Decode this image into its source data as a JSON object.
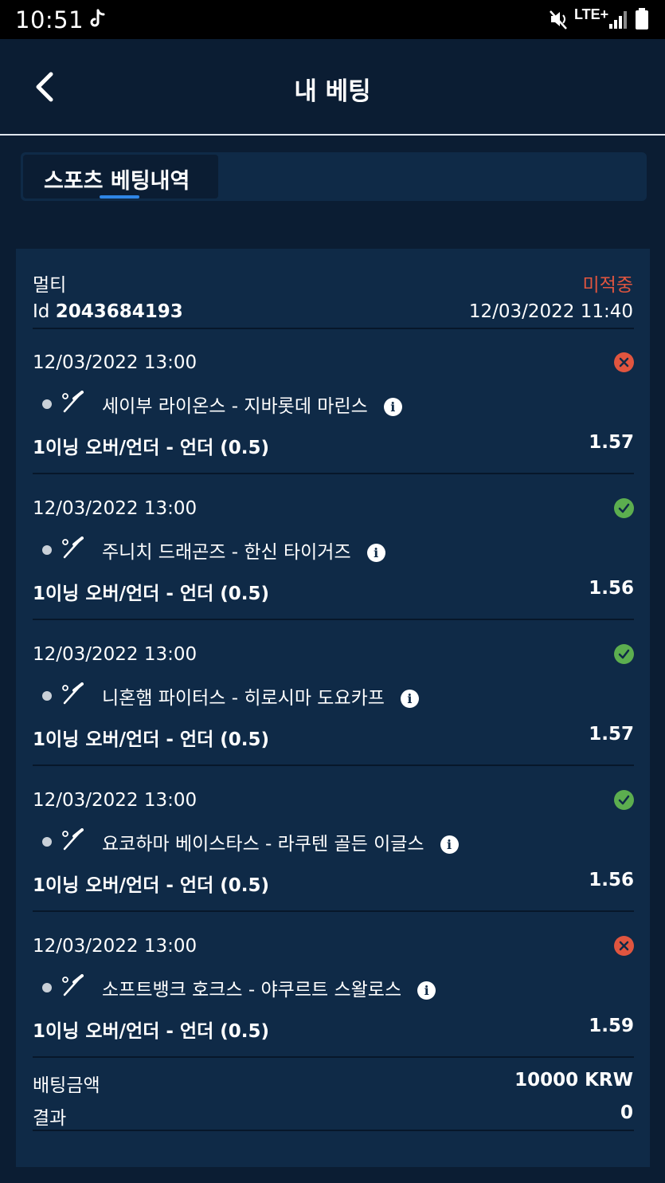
{
  "status_bar": {
    "time": "10:51",
    "icons": [
      "tiktok-icon",
      "mute-icon",
      "lte-icon",
      "signal-icon",
      "battery-icon"
    ],
    "network_label": "LTE+"
  },
  "header": {
    "title": "내 베팅",
    "back_icon": "chevron-left-icon"
  },
  "tabs": [
    {
      "label": "스포츠 베팅내역",
      "active": true
    }
  ],
  "bet": {
    "type": "멀티",
    "status": "미적중",
    "id_prefix": "Id",
    "id_number": "2043684193",
    "datetime": "12/03/2022 11:40",
    "selections": [
      {
        "date": "12/03/2022 13:00",
        "result": "lost",
        "event": "세이부 라이온스 - 지바롯데 마린스",
        "market": "1이닝 오버/언더 - 언더 (0.5)",
        "odds": "1.57"
      },
      {
        "date": "12/03/2022 13:00",
        "result": "won",
        "event": "주니치 드래곤즈 - 한신 타이거즈",
        "market": "1이닝 오버/언더 - 언더 (0.5)",
        "odds": "1.56"
      },
      {
        "date": "12/03/2022 13:00",
        "result": "won",
        "event": "니혼햄 파이터스 - 히로시마 도요카프",
        "market": "1이닝 오버/언더 - 언더 (0.5)",
        "odds": "1.57"
      },
      {
        "date": "12/03/2022 13:00",
        "result": "won",
        "event": "요코하마 베이스타스 - 라쿠텐 골든 이글스",
        "market": "1이닝 오버/언더 - 언더 (0.5)",
        "odds": "1.56"
      },
      {
        "date": "12/03/2022 13:00",
        "result": "lost",
        "event": "소프트뱅크 호크스 - 야쿠르트 스왈로스",
        "market": "1이닝 오버/언더 - 언더 (0.5)",
        "odds": "1.59"
      }
    ],
    "stake_label": "배팅금액",
    "stake_value": "10000 KRW",
    "result_label": "결과",
    "result_value": "0"
  },
  "colors": {
    "background": "#0b1d33",
    "card": "#0f2a47",
    "lost": "#e0553f",
    "won": "#5cae4f",
    "accent": "#2f86e6"
  }
}
